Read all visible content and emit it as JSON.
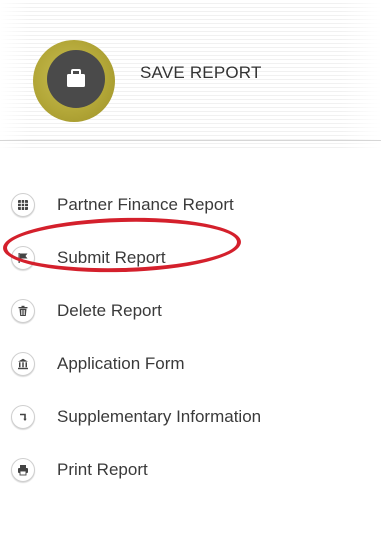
{
  "save_banner": {
    "label": "SAVE REPORT",
    "icon": "briefcase-icon",
    "accent_color": "#b3a738"
  },
  "menu": {
    "items": [
      {
        "label": "Partner Finance Report",
        "icon": "table-icon"
      },
      {
        "label": "Submit Report",
        "icon": "flag-icon",
        "highlighted": true
      },
      {
        "label": "Delete Report",
        "icon": "trash-icon"
      },
      {
        "label": "Application Form",
        "icon": "bank-icon"
      },
      {
        "label": "Supplementary Information",
        "icon": "corner-arrow-icon"
      },
      {
        "label": "Print Report",
        "icon": "printer-icon"
      }
    ],
    "highlight_color": "#d4202c"
  }
}
